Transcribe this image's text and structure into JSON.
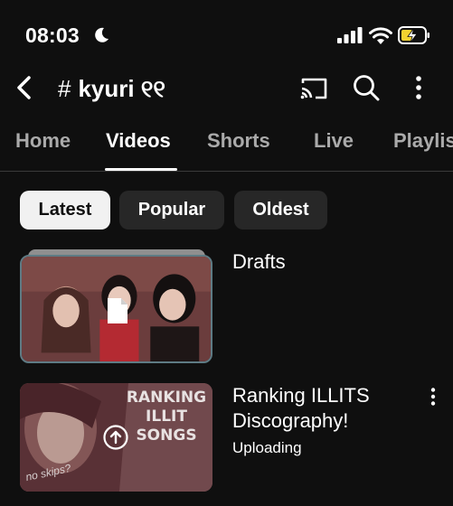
{
  "status_bar": {
    "time": "08:03"
  },
  "header": {
    "channel_hash": "#",
    "channel_name": "kyuri ୧୧"
  },
  "tabs": [
    {
      "label": "Home"
    },
    {
      "label": "Videos"
    },
    {
      "label": "Shorts"
    },
    {
      "label": "Live"
    },
    {
      "label": "Playlis"
    }
  ],
  "active_tab": "Videos",
  "filters": [
    {
      "label": "Latest"
    },
    {
      "label": "Popular"
    },
    {
      "label": "Oldest"
    }
  ],
  "active_filter": "Latest",
  "videos": [
    {
      "title": "Drafts",
      "status": ""
    },
    {
      "title": "Ranking ILLITS Discography!",
      "status": "Uploading",
      "thumb_text_lines": [
        "RANKING",
        "ILLIT",
        "SONGS"
      ],
      "thumb_caption": "no skips?"
    }
  ],
  "colors": {
    "background": "#0f0f0f",
    "chip_active": "#f1f1f1",
    "chip": "#272727",
    "tab_inactive": "#aaaaaa"
  }
}
